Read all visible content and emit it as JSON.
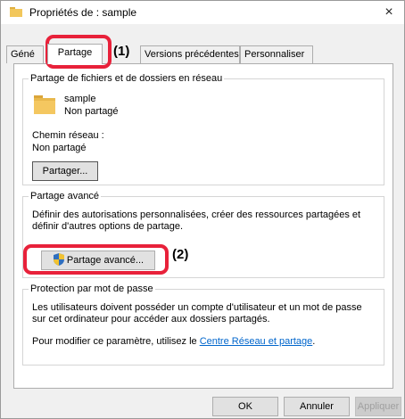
{
  "window": {
    "title": "Propriétés de : sample",
    "close_glyph": "×"
  },
  "tabs": [
    {
      "label": "Géné"
    },
    {
      "label": "Partage"
    },
    {
      "label": "Versions précédentes"
    },
    {
      "label": "Personnaliser"
    }
  ],
  "network_sharing": {
    "title": "Partage de fichiers et de dossiers en réseau",
    "item_name": "sample",
    "item_status": "Non partagé",
    "path_label": "Chemin réseau :",
    "path_value": "Non partagé",
    "share_button": "Partager..."
  },
  "advanced_sharing": {
    "title": "Partage avancé",
    "description": "Définir des autorisations personnalisées, créer des ressources partagées et définir d'autres options de partage.",
    "button": "Partage avancé..."
  },
  "password_protection": {
    "title": "Protection par mot de passe",
    "description": "Les utilisateurs doivent posséder un compte d'utilisateur et un mot de passe sur cet ordinateur pour accéder aux dossiers partagés.",
    "modify_text": "Pour modifier ce paramètre, utilisez le ",
    "link_text": "Centre Réseau et partage",
    "period": "."
  },
  "footer": {
    "ok": "OK",
    "cancel": "Annuler",
    "apply": "Appliquer"
  },
  "annotations": {
    "callout_1": "(1)",
    "callout_2": "(2)",
    "highlight_color": "#e8213a"
  }
}
